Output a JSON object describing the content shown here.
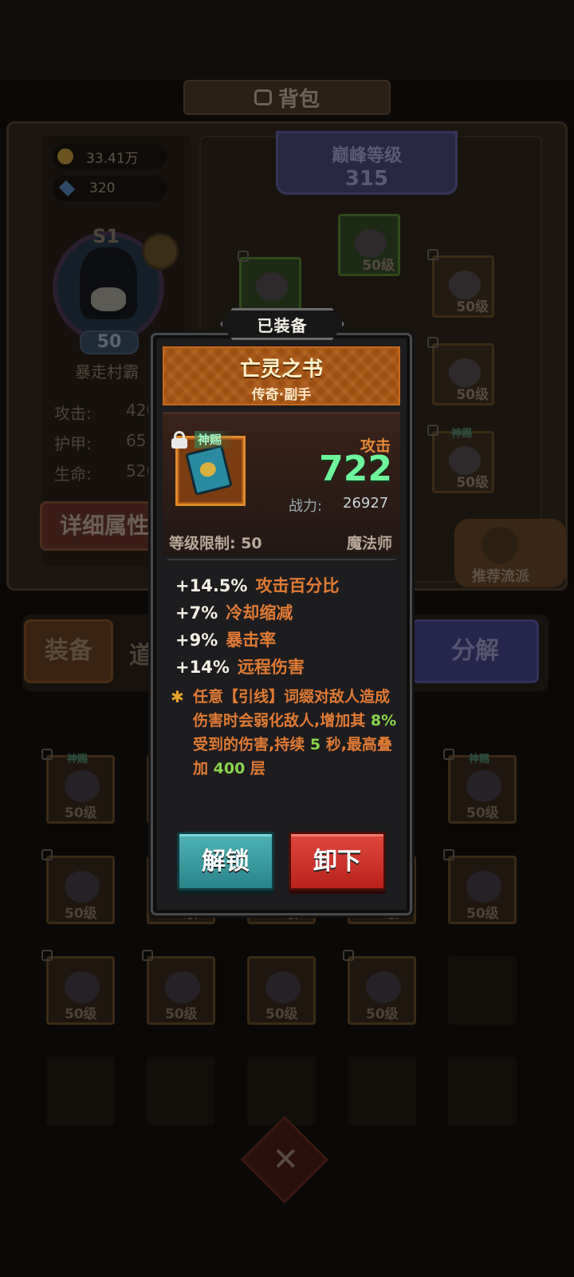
{
  "background": {
    "title": "背包",
    "currency": {
      "gold": "33.41万",
      "gems": "320"
    },
    "player": {
      "season": "S1",
      "level": "50",
      "name": "暴走村霸"
    },
    "stats": [
      {
        "label": "攻击:",
        "value": "420"
      },
      {
        "label": "护甲:",
        "value": "65"
      },
      {
        "label": "生命:",
        "value": "520"
      }
    ],
    "detail_button": "详细属性",
    "peak": {
      "title": "巅峰等级",
      "value": "315"
    },
    "equip_slot_levels": [
      "50级",
      "50级",
      "50级",
      "50级",
      "50级",
      "50级"
    ],
    "divine_tag": "神赐",
    "recommend_label": "推荐流派",
    "tabs": {
      "equip": "装备",
      "items": "道",
      "decompose": "分解"
    },
    "inventory_levels": [
      "50级",
      "50级",
      "50级",
      "50级",
      "50级",
      "50级",
      "50级",
      "50级",
      "50级",
      "50级",
      "50级",
      "50级"
    ]
  },
  "popup": {
    "status_tab": "已装备",
    "item_name": "亡灵之书",
    "item_subtitle": "传奇·副手",
    "divine_tag": "神赐",
    "main_stat_label": "攻击",
    "main_stat_value": "722",
    "power_label": "战力:",
    "power_value": "26927",
    "level_requirement": "等级限制: 50",
    "class_requirement": "魔法师",
    "affixes": [
      {
        "value": "+14.5%",
        "name": "攻击百分比"
      },
      {
        "value": "+7%",
        "name": "冷却缩减"
      },
      {
        "value": "+9%",
        "name": "暴击率"
      },
      {
        "value": "+14%",
        "name": "远程伤害"
      }
    ],
    "special_effect": {
      "part1": "任意【引线】词缀对敌人造成伤害时会弱化敌人,增加其 ",
      "v1": "8%",
      "part2": " 受到的伤害,持续 ",
      "v2": "5",
      "part3": " 秒,最高叠加 ",
      "v3": "400",
      "part4": " 层"
    },
    "buttons": {
      "unlock": "解锁",
      "unequip": "卸下"
    }
  },
  "colors": {
    "item_header": "#9e4f12",
    "attack_value": "#6ef59a",
    "affix_name": "#e07a34",
    "highlight": "#8ad44a",
    "unlock_button": "#2a8488",
    "unequip_button": "#b8221c"
  }
}
